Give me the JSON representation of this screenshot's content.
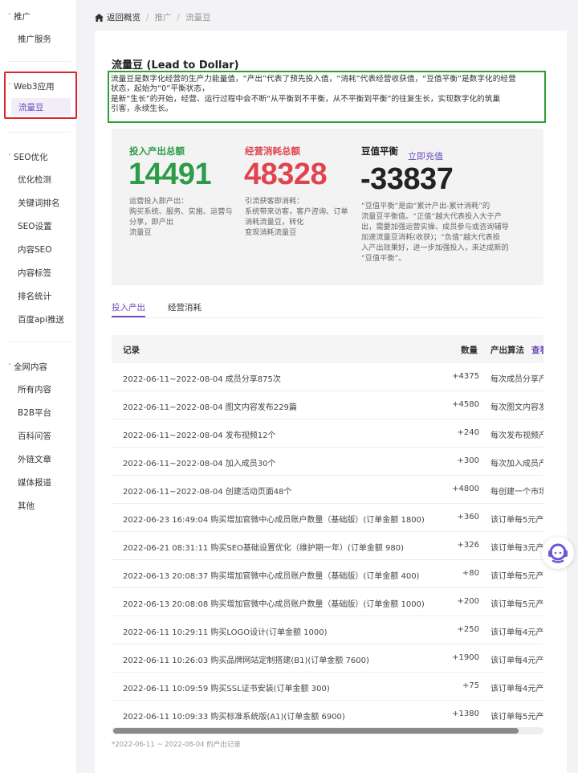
{
  "sidebar": {
    "groups": [
      {
        "label": "推广",
        "items": [
          "推广服务"
        ]
      },
      {
        "label": "Web3应用",
        "items": [
          "流量豆"
        ]
      },
      {
        "label": "SEO优化",
        "items": [
          "优化检测",
          "关键词排名",
          "SEO设置",
          "内容SEO",
          "内容标签",
          "排名统计",
          "百度api推送"
        ]
      },
      {
        "label": "全网内容",
        "items": [
          "所有内容",
          "B2B平台",
          "百科问答",
          "外链文章",
          "媒体报道",
          "其他"
        ]
      }
    ]
  },
  "breadcrumb": {
    "back": "返回概览",
    "level1": "推广",
    "level2": "流量豆",
    "sep": "/"
  },
  "page": {
    "title": "流量豆 (Lead to Dollar)",
    "desc": [
      "流量豆是数字化经营的生产力能量值，“产出”代表了预先投入值，“消耗”代表经营收获值，“豆值平衡”是数字化的经营",
      "状态，起始为“0”平衡状态，",
      "是新“生长”的开始，经营、运行过程中会不断“从平衡到不平衡，从不平衡到平衡”的往复生长，实现数字化的筑巢",
      "引客，永续生长。"
    ]
  },
  "stats": {
    "input": {
      "label": "投入产出总额",
      "value": "14491",
      "desc": [
        "运营投入即产出：",
        "购买系统、服务、实施、运营与",
        "分享，即产出",
        "流量豆"
      ]
    },
    "consume": {
      "label": "经营消耗总额",
      "value": "48328",
      "desc": [
        "引流获客即消耗：",
        "系统带来访客，客户咨询、订单",
        "消耗流量豆，转化",
        "变现消耗流量豆"
      ]
    },
    "balance": {
      "label": "豆值平衡",
      "value": "-33837",
      "topup": "立即充值",
      "desc": [
        "“豆值平衡”是由“累计产出-累计消耗”的",
        "流量豆平衡值。“正值”越大代表投入大于产",
        "出，需要加强运营实操、成员参与或咨询辅导",
        "加速流量豆消耗(收获)；“负值”越大代表投",
        "入产出效果好，进一步加强投入，来达成新的",
        "“豆值平衡”。"
      ]
    }
  },
  "tabs": [
    {
      "label": "投入产出",
      "active": true
    },
    {
      "label": "经营消耗",
      "active": false
    }
  ],
  "table": {
    "headers": {
      "record": "记录",
      "qty": "数量",
      "algo": "产出算法",
      "view": "查看"
    },
    "rows": [
      {
        "record": "2022-06-11~2022-08-04 成员分享875次",
        "qty": "+4375",
        "algo": "每次成员分享产"
      },
      {
        "record": "2022-06-11~2022-08-04 图文内容发布229篇",
        "qty": "+4580",
        "algo": "每次图文内容发"
      },
      {
        "record": "2022-06-11~2022-08-04 发布视频12个",
        "qty": "+240",
        "algo": "每次发布视频产"
      },
      {
        "record": "2022-06-11~2022-08-04 加入成员30个",
        "qty": "+300",
        "algo": "每次加入成员产"
      },
      {
        "record": "2022-06-11~2022-08-04 创建活动页面48个",
        "qty": "+4800",
        "algo": "每创建一个市场"
      },
      {
        "record": "2022-06-23 16:49:04 购买增加官微中心成员账户数量（基础版）(订单金额 1800)",
        "qty": "+360",
        "algo": "该订单每5元产"
      },
      {
        "record": "2022-06-21 08:31:11 购买SEO基础设置优化（维护期一年）(订单金额 980)",
        "qty": "+326",
        "algo": "该订单每3元产"
      },
      {
        "record": "2022-06-13 20:08:37 购买增加官微中心成员账户数量（基础版）(订单金额 400)",
        "qty": "+80",
        "algo": "该订单每5元产"
      },
      {
        "record": "2022-06-13 20:08:08 购买增加官微中心成员账户数量（基础版）(订单金额 1000)",
        "qty": "+200",
        "algo": "该订单每5元产"
      },
      {
        "record": "2022-06-11 10:29:11 购买LOGO设计(订单金额 1000)",
        "qty": "+250",
        "algo": "该订单每4元产"
      },
      {
        "record": "2022-06-11 10:26:03 购买品牌网站定制搭建(B1)(订单金额 7600)",
        "qty": "+1900",
        "algo": "该订单每4元产"
      },
      {
        "record": "2022-06-11 10:09:59 购买SSL证书安装(订单金额 300)",
        "qty": "+75",
        "algo": "该订单每4元产"
      },
      {
        "record": "2022-06-11 10:09:33 购买标准系统版(A1)(订单金额 6900)",
        "qty": "+1380",
        "algo": "该订单每5元产"
      }
    ],
    "footnote": "*2022-06-11 ~ 2022-08-04 的产出记录"
  },
  "colors": {
    "accent": "#6b4fbb",
    "green": "#2e9b48",
    "red": "#e0454f",
    "dark": "#222222",
    "annotation_red": "#d9262c",
    "annotation_green": "#2f9e33"
  },
  "icons": {
    "home": "home-icon",
    "support": "customer-service-icon"
  }
}
